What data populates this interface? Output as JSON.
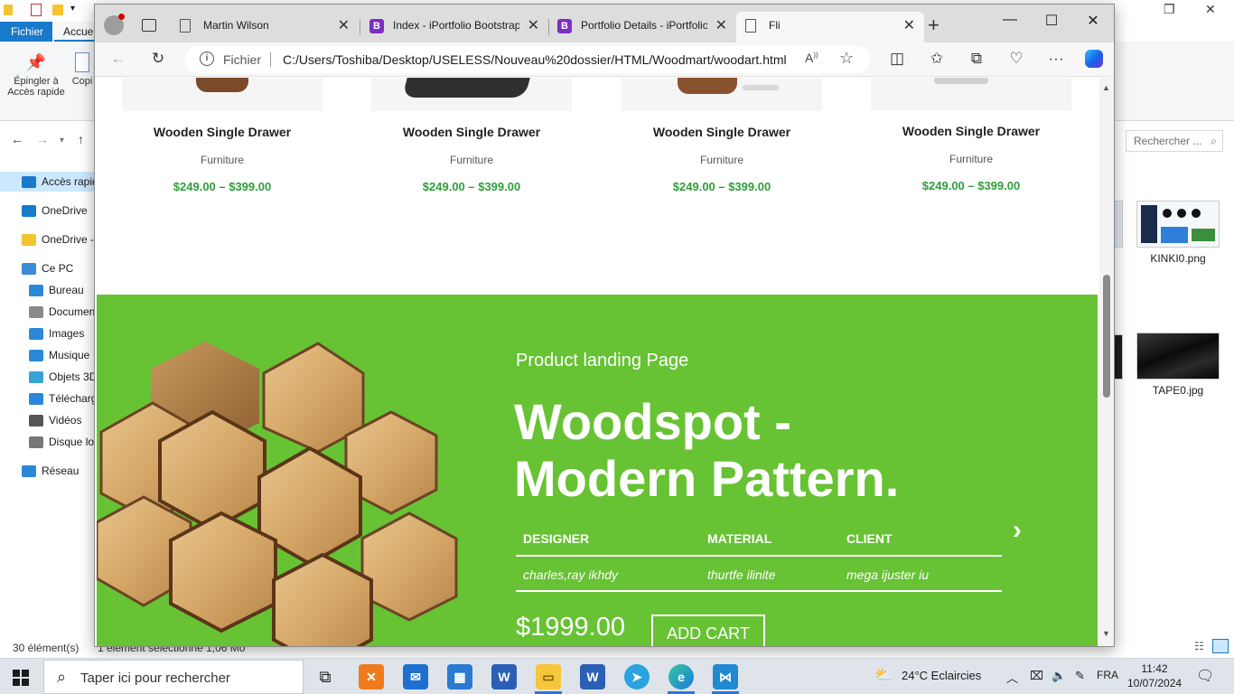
{
  "explorer": {
    "ribbon_tab_file": "Fichier",
    "ribbon_tab_home": "Accueil",
    "pin_label_1": "Épingler à",
    "pin_label_2": "Accès rapide",
    "copy_label": "Copi",
    "search_placeholder": "Rechercher ...",
    "sidebar": [
      {
        "label": "Accès rapide",
        "icon": "star-icon",
        "color": "#1979ca"
      },
      {
        "label": "OneDrive",
        "icon": "cloud-icon",
        "color": "#1979ca"
      },
      {
        "label": "OneDrive -",
        "icon": "folder-icon",
        "color": "#f4c430"
      },
      {
        "label": "Ce PC",
        "icon": "computer-icon",
        "color": "#3b8bd6"
      },
      {
        "label": "Bureau",
        "icon": "desktop-icon",
        "color": "#2b88d8"
      },
      {
        "label": "Documen",
        "icon": "document-icon",
        "color": "#8a8a8a"
      },
      {
        "label": "Images",
        "icon": "images-icon",
        "color": "#2b88d8"
      },
      {
        "label": "Musique",
        "icon": "music-icon",
        "color": "#2b88d8"
      },
      {
        "label": "Objets 3D",
        "icon": "cube-icon",
        "color": "#37a4d8"
      },
      {
        "label": "Télécharg",
        "icon": "download-icon",
        "color": "#2b88d8"
      },
      {
        "label": "Vidéos",
        "icon": "video-icon",
        "color": "#555555"
      },
      {
        "label": "Disque lo",
        "icon": "drive-icon",
        "color": "#777777"
      },
      {
        "label": "Réseau",
        "icon": "network-icon",
        "color": "#2b88d8"
      }
    ],
    "status_count": "30 élément(s)",
    "status_selection": "1 élément sélectionné  1,06 Mo",
    "files": [
      {
        "name": "KINKI0.png"
      },
      {
        "name": "TAPE0.jpg"
      }
    ]
  },
  "browser": {
    "tabs": [
      {
        "title": "Martin Wilson",
        "icon": "page-icon"
      },
      {
        "title": "Index - iPortfolio Bootstrap",
        "icon": "bootstrap-icon",
        "icon_text": "B"
      },
      {
        "title": "Portfolio Details - iPortfolio",
        "icon": "bootstrap-icon",
        "icon_text": "B"
      },
      {
        "title": "Fli",
        "icon": "page-icon",
        "active": true
      }
    ],
    "address": {
      "scheme": "Fichier",
      "url": "C:/Users/Toshiba/Desktop/USELESS/Nouveau%20dossier/HTML/Woodmart/woodart.html"
    },
    "accent_color": "#7b2fbf"
  },
  "page": {
    "products": [
      {
        "name": "Wooden Single Drawer",
        "category": "Furniture",
        "price": "$249.00 – $399.00"
      },
      {
        "name": "Wooden Single Drawer",
        "category": "Furniture",
        "price": "$249.00 – $399.00"
      },
      {
        "name": "Wooden Single Drawer",
        "category": "Furniture",
        "price": "$249.00 – $399.00"
      },
      {
        "name": "Wooden Single Drawer",
        "category": "Furniture",
        "price": "$249.00 – $399.00"
      }
    ],
    "price_color": "#2f9e3a",
    "hero": {
      "background": "#67c234",
      "subtitle": "Product landing Page",
      "title_line1": "Woodspot -",
      "title_line2": "Modern Pattern.",
      "specs": {
        "headers": [
          "DESIGNER",
          "MATERIAL",
          "CLIENT"
        ],
        "values": [
          "charles,ray ikhdy",
          "thurtfe ilinite",
          "mega ijuster iu"
        ]
      },
      "price": "$1999.00",
      "cta": "ADD CART"
    }
  },
  "taskbar": {
    "search_placeholder": "Taper ici pour rechercher",
    "weather": "24°C  Eclaircies",
    "language": "FRA",
    "time": "11:42",
    "date": "10/07/2024"
  }
}
